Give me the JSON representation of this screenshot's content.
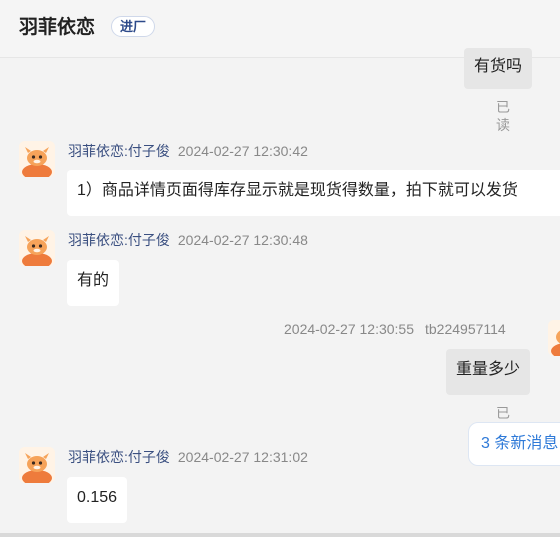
{
  "header": {
    "shop_name": "羽菲依恋",
    "store_badge": "进厂"
  },
  "messages": [
    {
      "direction": "out",
      "text": "有货吗",
      "status": "已读"
    },
    {
      "direction": "in",
      "sender": "羽菲依恋:付子俊",
      "time": "2024-02-27 12:30:42",
      "text": "1）商品详情页面得库存显示就是现货得数量，拍下就可以发货"
    },
    {
      "direction": "in",
      "sender": "羽菲依恋:付子俊",
      "time": "2024-02-27 12:30:48",
      "text": "有的"
    },
    {
      "direction": "out",
      "time": "2024-02-27 12:30:55",
      "sender": "tb224957114",
      "text": "重量多少",
      "status": "已读"
    },
    {
      "direction": "in",
      "sender": "羽菲依恋:付子俊",
      "time": "2024-02-27 12:31:02",
      "text": "0.156"
    }
  ],
  "new_messages_label": "3 条新消息",
  "colors": {
    "background": "#f3f3f3",
    "incoming_bubble": "#ffffff",
    "outgoing_bubble": "#e6e6e6",
    "sender_name": "#3a4f80",
    "new_messages_text": "#2f7ad8"
  },
  "icons": {
    "agent_avatar": "cartoon-mascot-avatar",
    "user_avatar": "cartoon-mascot-avatar"
  }
}
